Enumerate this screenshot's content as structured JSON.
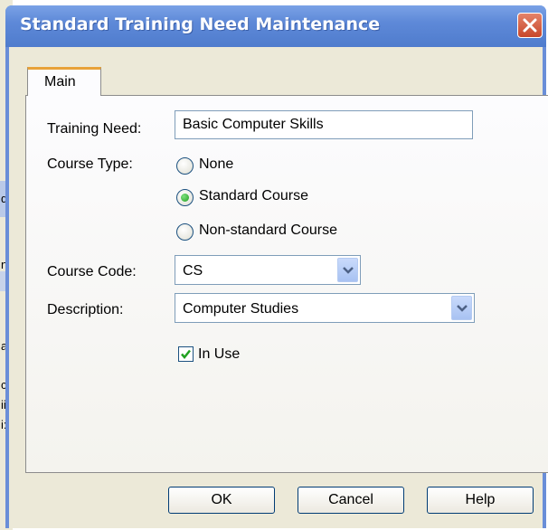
{
  "window": {
    "title": "Standard Training Need Maintenance"
  },
  "tabs": [
    {
      "label": "Main"
    }
  ],
  "form": {
    "training_need": {
      "label": "Training Need:",
      "value": "Basic Computer Skills"
    },
    "course_type": {
      "label": "Course Type:",
      "options": [
        "None",
        "Standard Course",
        "Non-standard Course"
      ],
      "selected": "Standard Course"
    },
    "course_code": {
      "label": "Course Code:",
      "value": "CS"
    },
    "description": {
      "label": "Description:",
      "value": "Computer Studies"
    },
    "in_use": {
      "label": "In Use",
      "checked": true
    }
  },
  "buttons": {
    "ok": "OK",
    "cancel": "Cancel",
    "help": "Help"
  },
  "background_fragments": [
    "d",
    "n",
    "a",
    "c",
    "ii",
    "i:"
  ],
  "colors": {
    "titlebar": "#5e89d8",
    "dialog_face": "#ece9d8",
    "close_button": "#c8472b",
    "radio_dot": "#21a121",
    "check_mark": "#21a121"
  },
  "icons": {
    "close": "close-icon",
    "dropdown": "chevron-down-icon",
    "check": "check-icon"
  }
}
